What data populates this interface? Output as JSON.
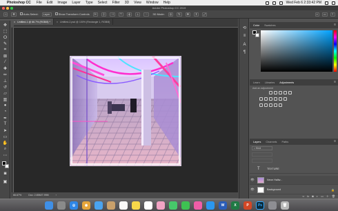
{
  "menubar": {
    "app_name": "Photoshop CC",
    "items": [
      "File",
      "Edit",
      "Image",
      "Layer",
      "Type",
      "Select",
      "Filter",
      "3D",
      "View",
      "Window",
      "Help"
    ],
    "clock": "Wed Feb 6  2:33:42 PM"
  },
  "titlebar": {
    "title": "Adobe Photoshop CC 2019"
  },
  "options": {
    "auto_select_label": "Auto-Select:",
    "auto_select_value": "Layer",
    "show_transform_label": "Show Transform Controls",
    "mode_3d_label": "3D Mode:"
  },
  "tabs": [
    {
      "label": "Untitled-1 @ 66.7% (RGB/8) *",
      "active": true
    },
    {
      "label": "Untitled-2.psd @ 100% (Rectangle 1, RGB/8)",
      "active": false
    }
  ],
  "status": {
    "zoom": "66.67%",
    "doc": "Doc: 2.85M/7.99M"
  },
  "panels": {
    "color_tabs": [
      "Color",
      "Swatches"
    ],
    "learn_tabs": [
      "Learn",
      "Libraries",
      "Adjustments"
    ],
    "adjust_hint": "Add an adjustment",
    "layers_tabs": [
      "Layers",
      "Channels",
      "Paths"
    ],
    "layers_kind": "Kind"
  },
  "layers": [
    {
      "name": "TEXTURE",
      "kind": "text"
    },
    {
      "name": "Neon Hallw...",
      "kind": "image"
    },
    {
      "name": "Background",
      "kind": "background"
    }
  ],
  "dock_icons": [
    "finder-icon",
    "launchpad-icon",
    "safari-icon",
    "chrome-icon",
    "mail-icon",
    "contacts-icon",
    "calendar-icon",
    "notes-icon",
    "reminders-icon",
    "photos-icon",
    "messages-icon",
    "facetime-icon",
    "itunes-icon",
    "appstore-icon",
    "word-icon",
    "excel-icon",
    "powerpoint-icon",
    "photoshop-icon",
    "preferences-icon",
    "trash-icon"
  ],
  "colors": {
    "accent": "#00a2ff",
    "canvas_bg": "#282828",
    "panel_bg": "#535353"
  }
}
